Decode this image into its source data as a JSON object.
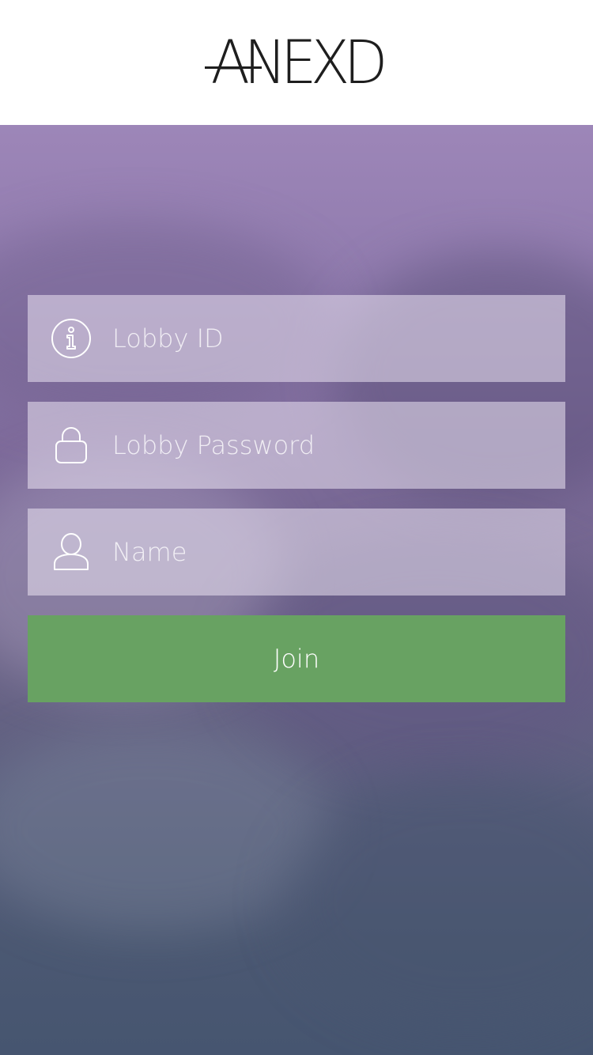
{
  "header": {
    "logo_text": "ANEXD"
  },
  "form": {
    "lobby_id": {
      "placeholder": "Lobby ID",
      "value": "",
      "icon": "info-icon"
    },
    "lobby_password": {
      "placeholder": "Lobby Password",
      "value": "",
      "icon": "lock-icon"
    },
    "name": {
      "placeholder": "Name",
      "value": "",
      "icon": "user-icon"
    },
    "join_label": "Join"
  },
  "colors": {
    "header_bg": "#ffffff",
    "logo": "#1e1e1e",
    "join_button": "#68a262",
    "background_top": "#9d86b8",
    "background_bottom": "#465570"
  }
}
